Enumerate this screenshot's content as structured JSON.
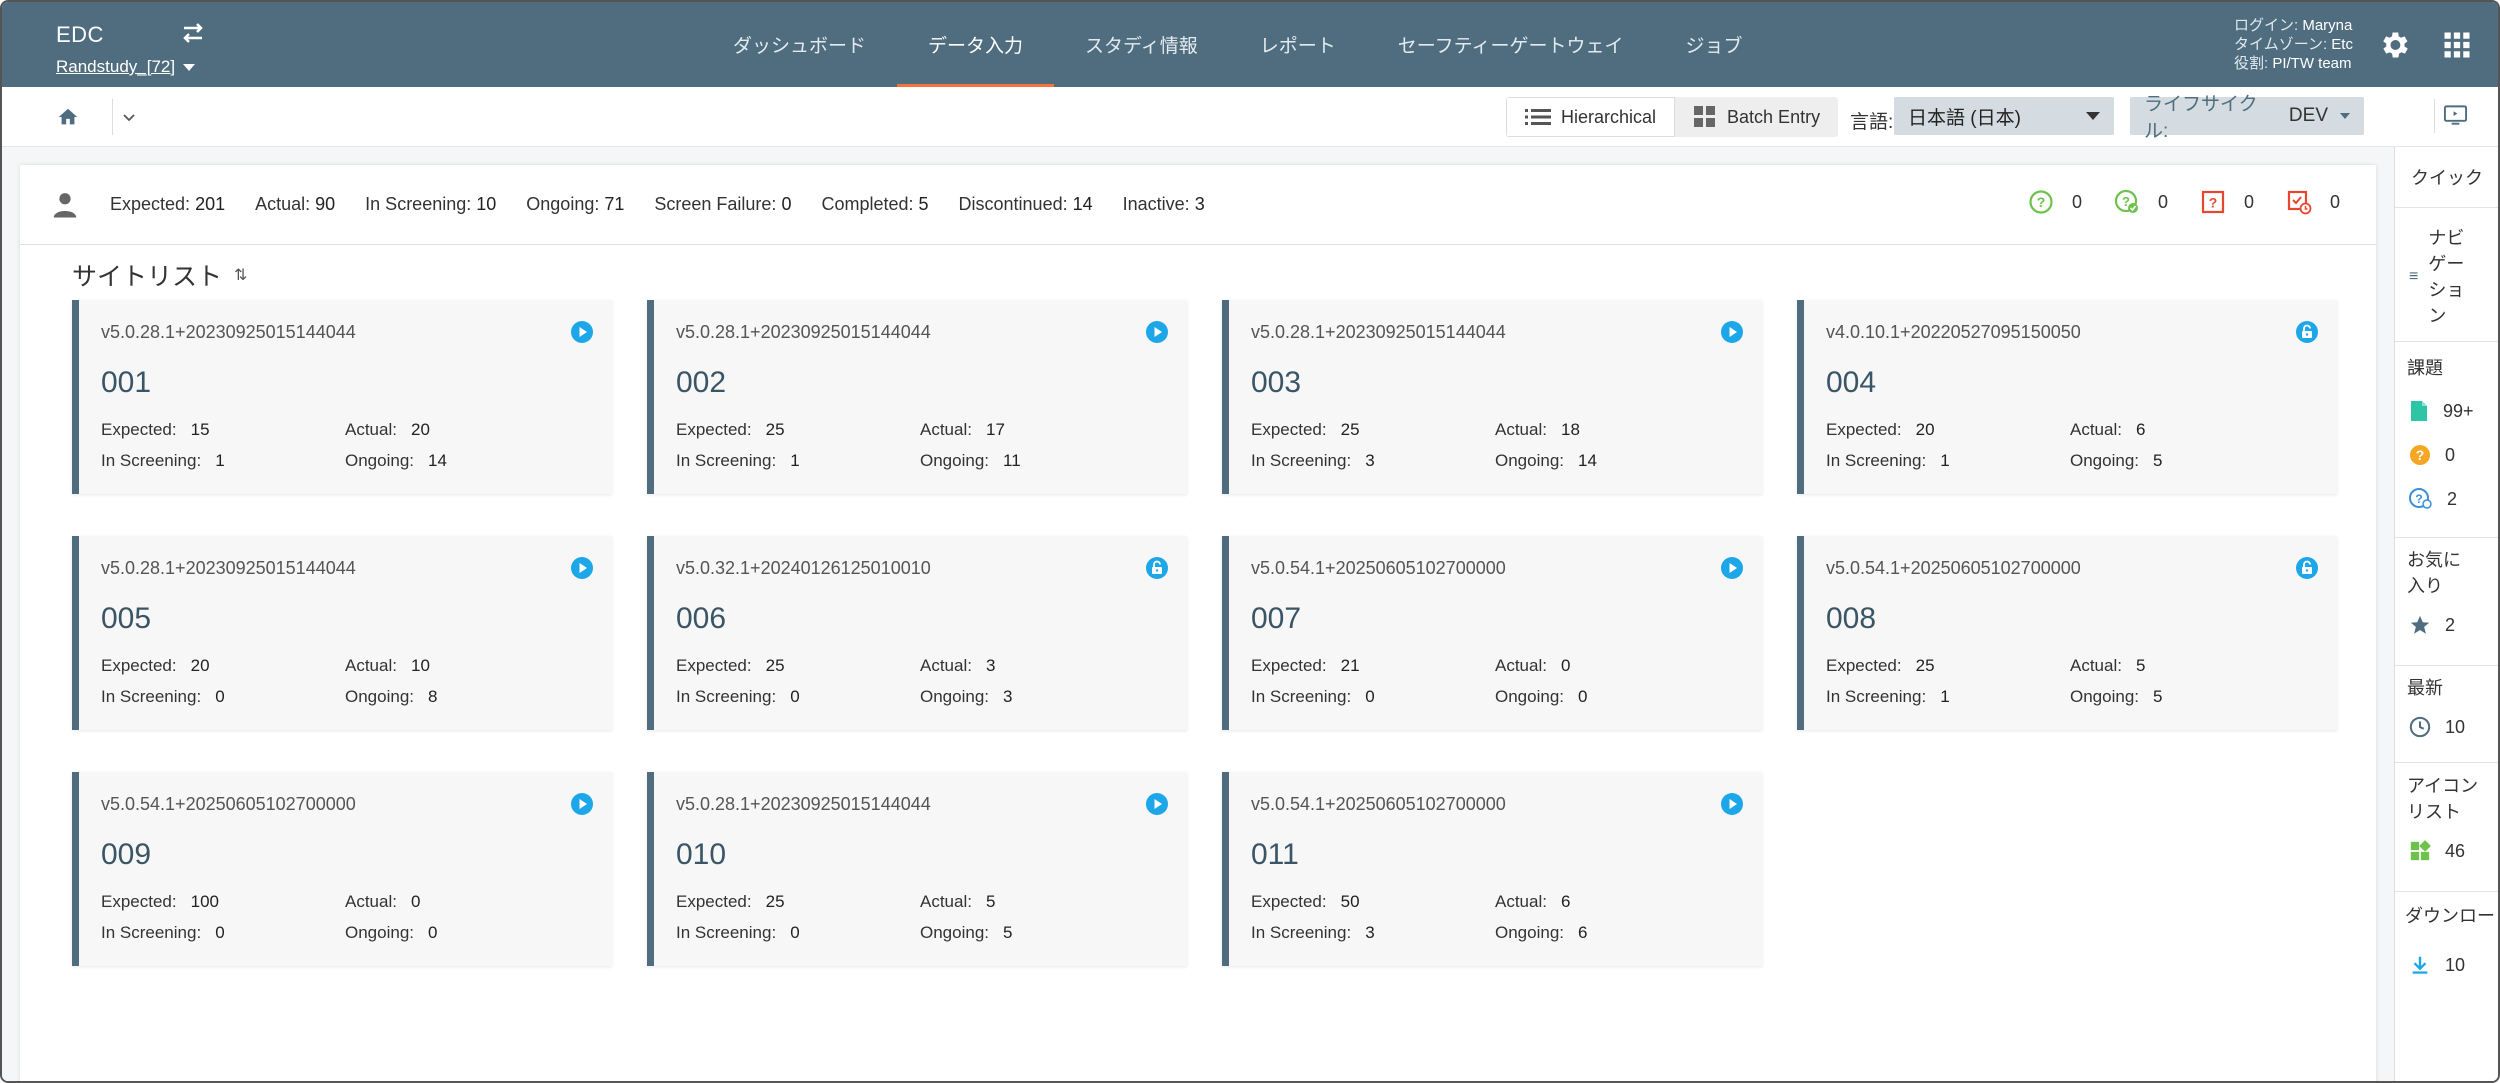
{
  "header": {
    "app_title": "EDC",
    "study": "Randstudy_[72]",
    "nav": [
      "ダッシュボード",
      "データ入力",
      "スタディ情報",
      "レポート",
      "セーフティーゲートウェイ",
      "ジョブ"
    ],
    "active_nav": "データ入力",
    "login_label": "ログイン: ",
    "login_value": "Maryna",
    "timezone_label": "タイムゾーン: ",
    "timezone_value": "Etc",
    "role_label": "役割: ",
    "role_value": "PI/TW team"
  },
  "toolbar": {
    "view_hierarchical": "Hierarchical",
    "view_batch": "Batch Entry",
    "language_label": "言語:",
    "language_value": "日本語 (日本)",
    "lifecycle_label": "ライフサイクル:",
    "lifecycle_value": "DEV"
  },
  "stats": {
    "expected_label": "Expected: ",
    "expected": "201",
    "actual_label": "Actual: ",
    "actual": "90",
    "screening_label": "In Screening: ",
    "screening": "10",
    "ongoing_label": "Ongoing: ",
    "ongoing": "71",
    "failure_label": "Screen Failure: ",
    "failure": "0",
    "completed_label": "Completed: ",
    "completed": "5",
    "discontinued_label": "Discontinued: ",
    "discontinued": "14",
    "inactive_label": "Inactive: ",
    "inactive": "3",
    "icon_counts": [
      "0",
      "0",
      "0",
      "0"
    ]
  },
  "site_list_title": "サイトリスト",
  "sites": [
    {
      "version": "v5.0.28.1+20230925015144044",
      "site": "001",
      "expected": "15",
      "actual": "20",
      "screening": "1",
      "ongoing": "14",
      "badge": "play"
    },
    {
      "version": "v5.0.28.1+20230925015144044",
      "site": "002",
      "expected": "25",
      "actual": "17",
      "screening": "1",
      "ongoing": "11",
      "badge": "play"
    },
    {
      "version": "v5.0.28.1+20230925015144044",
      "site": "003",
      "expected": "25",
      "actual": "18",
      "screening": "3",
      "ongoing": "14",
      "badge": "play"
    },
    {
      "version": "v4.0.10.1+20220527095150050",
      "site": "004",
      "expected": "20",
      "actual": "6",
      "screening": "1",
      "ongoing": "5",
      "badge": "lock"
    },
    {
      "version": "v5.0.28.1+20230925015144044",
      "site": "005",
      "expected": "20",
      "actual": "10",
      "screening": "0",
      "ongoing": "8",
      "badge": "play"
    },
    {
      "version": "v5.0.32.1+20240126125010010",
      "site": "006",
      "expected": "25",
      "actual": "3",
      "screening": "0",
      "ongoing": "3",
      "badge": "lock"
    },
    {
      "version": "v5.0.54.1+20250605102700000",
      "site": "007",
      "expected": "21",
      "actual": "0",
      "screening": "0",
      "ongoing": "0",
      "badge": "play"
    },
    {
      "version": "v5.0.54.1+20250605102700000",
      "site": "008",
      "expected": "25",
      "actual": "5",
      "screening": "1",
      "ongoing": "5",
      "badge": "lock"
    },
    {
      "version": "v5.0.54.1+20250605102700000",
      "site": "009",
      "expected": "100",
      "actual": "0",
      "screening": "0",
      "ongoing": "0",
      "badge": "play"
    },
    {
      "version": "v5.0.28.1+20230925015144044",
      "site": "010",
      "expected": "25",
      "actual": "5",
      "screening": "0",
      "ongoing": "5",
      "badge": "play"
    },
    {
      "version": "v5.0.54.1+20250605102700000",
      "site": "011",
      "expected": "50",
      "actual": "6",
      "screening": "3",
      "ongoing": "6",
      "badge": "play"
    }
  ],
  "card_labels": {
    "expected": "Expected:",
    "actual": "Actual:",
    "screening": "In Screening:",
    "ongoing": "Ongoing:"
  },
  "sidebar": {
    "quick": "クイック",
    "navigation": "ナビゲーション",
    "issues": "課題",
    "issue_counts": [
      "99+",
      "0",
      "2"
    ],
    "favorites": "お気に入り",
    "favorites_count": "2",
    "recent": "最新",
    "recent_count": "10",
    "icon_list": "アイコンリスト",
    "icon_list_count": "46",
    "downloads": "ダウンロー",
    "downloads_count": "10"
  },
  "colors": {
    "header_bg": "#4f6d7f",
    "accent": "#f4743b",
    "play_badge": "#1ea7e8",
    "card_border": "#4f6d7f"
  }
}
